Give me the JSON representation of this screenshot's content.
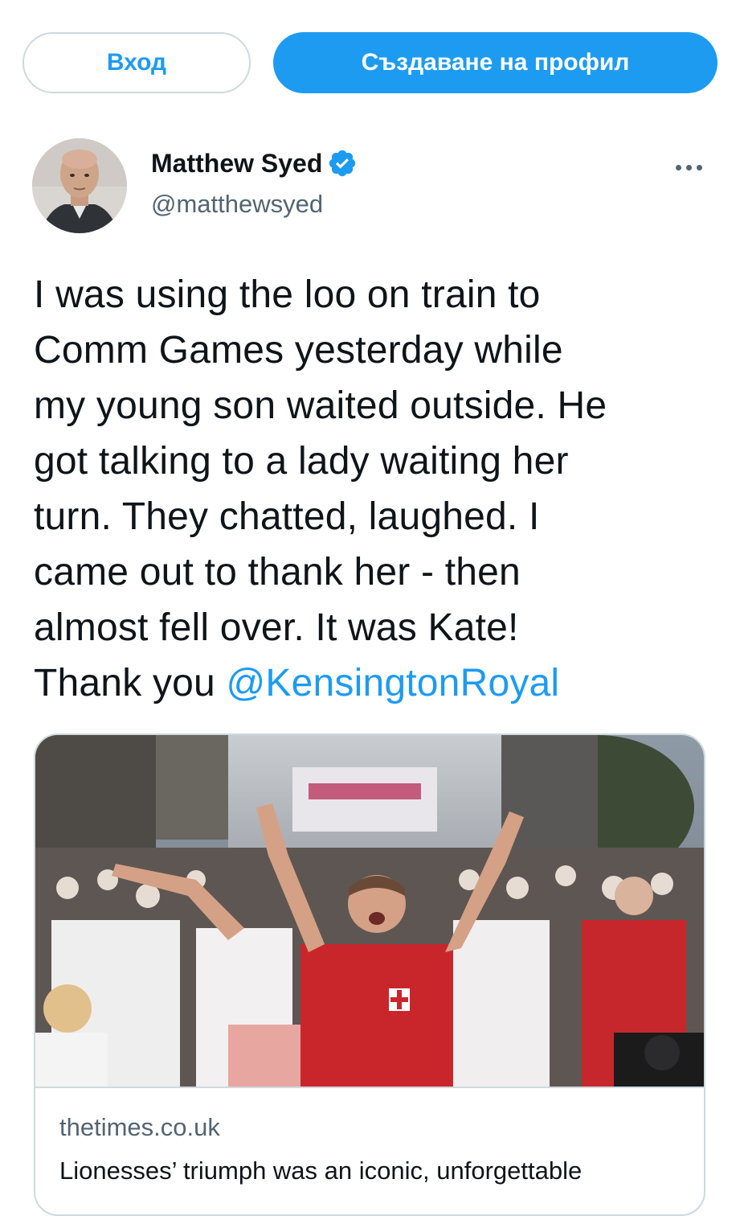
{
  "auth": {
    "login_label": "Вход",
    "signup_label": "Създаване на профил"
  },
  "tweet": {
    "author": {
      "name": "Matthew Syed",
      "handle": "@matthewsyed",
      "verified": true
    },
    "text_lines": [
      "I was using the loo on train to",
      "Comm Games yesterday while",
      "my young son waited outside. He",
      "got talking to a lady waiting her",
      "turn. They chatted, laughed. I",
      "came out to thank her - then",
      "almost fell over. It was Kate!"
    ],
    "last_line_prefix": "Thank you ",
    "mention": "@KensingtonRoyal"
  },
  "card": {
    "domain": "thetimes.co.uk",
    "title": "Lionesses’ triumph was an iconic, unforgettable",
    "image_icon": "photo-crowd-celebrating"
  },
  "colors": {
    "accent": "#1d9bf0",
    "text": "#0f1419",
    "secondary": "#536471",
    "border": "#cfd9de"
  }
}
